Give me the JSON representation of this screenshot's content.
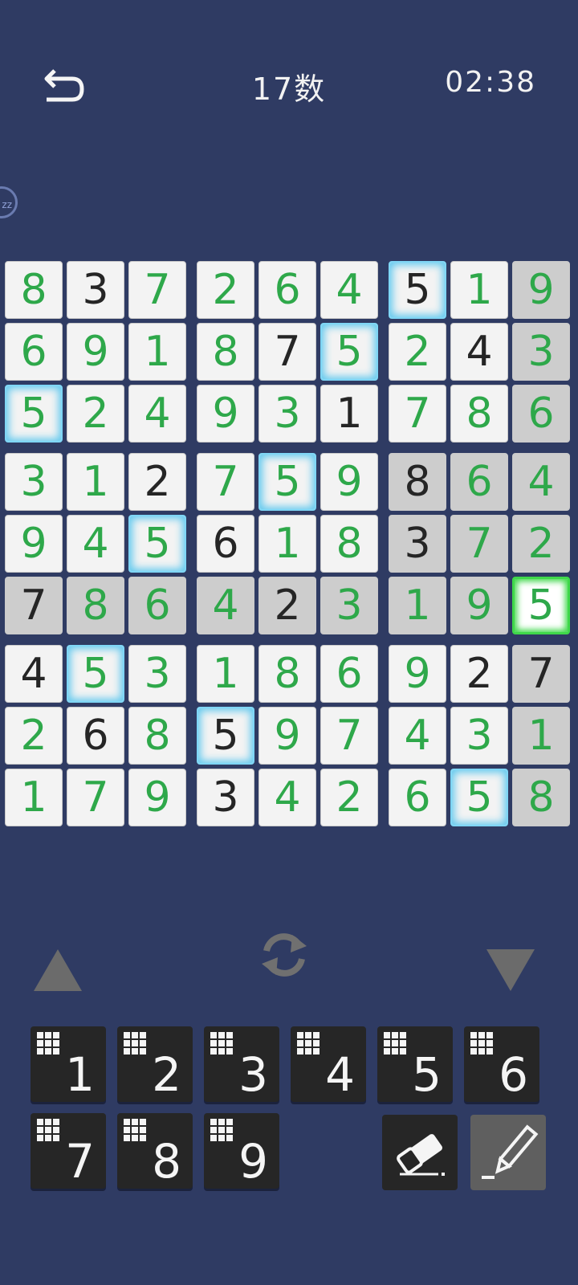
{
  "header": {
    "title": "17数",
    "timer": "02:38"
  },
  "sleep_label": "zz",
  "board": [
    [
      {
        "v": "8",
        "c": "g"
      },
      {
        "v": "3",
        "c": "b"
      },
      {
        "v": "7",
        "c": "g"
      },
      {
        "v": "2",
        "c": "g"
      },
      {
        "v": "6",
        "c": "g"
      },
      {
        "v": "4",
        "c": "g"
      },
      {
        "v": "5",
        "c": "b",
        "h": "glow"
      },
      {
        "v": "1",
        "c": "g"
      },
      {
        "v": "9",
        "c": "g",
        "h": "gray"
      }
    ],
    [
      {
        "v": "6",
        "c": "g"
      },
      {
        "v": "9",
        "c": "g"
      },
      {
        "v": "1",
        "c": "g"
      },
      {
        "v": "8",
        "c": "g"
      },
      {
        "v": "7",
        "c": "b"
      },
      {
        "v": "5",
        "c": "g",
        "h": "glow"
      },
      {
        "v": "2",
        "c": "g"
      },
      {
        "v": "4",
        "c": "b"
      },
      {
        "v": "3",
        "c": "g",
        "h": "gray"
      }
    ],
    [
      {
        "v": "5",
        "c": "g",
        "h": "glow"
      },
      {
        "v": "2",
        "c": "g"
      },
      {
        "v": "4",
        "c": "g"
      },
      {
        "v": "9",
        "c": "g"
      },
      {
        "v": "3",
        "c": "g"
      },
      {
        "v": "1",
        "c": "b"
      },
      {
        "v": "7",
        "c": "g"
      },
      {
        "v": "8",
        "c": "g"
      },
      {
        "v": "6",
        "c": "g",
        "h": "gray"
      }
    ],
    [
      {
        "v": "3",
        "c": "g"
      },
      {
        "v": "1",
        "c": "g"
      },
      {
        "v": "2",
        "c": "b"
      },
      {
        "v": "7",
        "c": "g"
      },
      {
        "v": "5",
        "c": "g",
        "h": "glow"
      },
      {
        "v": "9",
        "c": "g"
      },
      {
        "v": "8",
        "c": "b",
        "h": "gray"
      },
      {
        "v": "6",
        "c": "g",
        "h": "gray"
      },
      {
        "v": "4",
        "c": "g",
        "h": "gray"
      }
    ],
    [
      {
        "v": "9",
        "c": "g"
      },
      {
        "v": "4",
        "c": "g"
      },
      {
        "v": "5",
        "c": "g",
        "h": "glow"
      },
      {
        "v": "6",
        "c": "b"
      },
      {
        "v": "1",
        "c": "g"
      },
      {
        "v": "8",
        "c": "g"
      },
      {
        "v": "3",
        "c": "b",
        "h": "gray"
      },
      {
        "v": "7",
        "c": "g",
        "h": "gray"
      },
      {
        "v": "2",
        "c": "g",
        "h": "gray"
      }
    ],
    [
      {
        "v": "7",
        "c": "b",
        "h": "gray"
      },
      {
        "v": "8",
        "c": "g",
        "h": "gray"
      },
      {
        "v": "6",
        "c": "g",
        "h": "gray"
      },
      {
        "v": "4",
        "c": "g",
        "h": "gray"
      },
      {
        "v": "2",
        "c": "b",
        "h": "gray"
      },
      {
        "v": "3",
        "c": "g",
        "h": "gray"
      },
      {
        "v": "1",
        "c": "g",
        "h": "gray"
      },
      {
        "v": "9",
        "c": "g",
        "h": "gray"
      },
      {
        "v": "5",
        "c": "g",
        "h": "sel"
      }
    ],
    [
      {
        "v": "4",
        "c": "b"
      },
      {
        "v": "5",
        "c": "g",
        "h": "glow"
      },
      {
        "v": "3",
        "c": "g"
      },
      {
        "v": "1",
        "c": "g"
      },
      {
        "v": "8",
        "c": "g"
      },
      {
        "v": "6",
        "c": "g"
      },
      {
        "v": "9",
        "c": "g"
      },
      {
        "v": "2",
        "c": "b"
      },
      {
        "v": "7",
        "c": "b",
        "h": "gray"
      }
    ],
    [
      {
        "v": "2",
        "c": "g"
      },
      {
        "v": "6",
        "c": "b"
      },
      {
        "v": "8",
        "c": "g"
      },
      {
        "v": "5",
        "c": "b",
        "h": "glow"
      },
      {
        "v": "9",
        "c": "g"
      },
      {
        "v": "7",
        "c": "g"
      },
      {
        "v": "4",
        "c": "g"
      },
      {
        "v": "3",
        "c": "g"
      },
      {
        "v": "1",
        "c": "g",
        "h": "gray"
      }
    ],
    [
      {
        "v": "1",
        "c": "g"
      },
      {
        "v": "7",
        "c": "g"
      },
      {
        "v": "9",
        "c": "g"
      },
      {
        "v": "3",
        "c": "b"
      },
      {
        "v": "4",
        "c": "g"
      },
      {
        "v": "2",
        "c": "g"
      },
      {
        "v": "6",
        "c": "g"
      },
      {
        "v": "5",
        "c": "g",
        "h": "glow"
      },
      {
        "v": "8",
        "c": "g",
        "h": "gray"
      }
    ]
  ],
  "keypad": [
    "1",
    "2",
    "3",
    "4",
    "5",
    "6",
    "7",
    "8",
    "9"
  ],
  "colors": {
    "background": "#2f3b63",
    "given": "#252525",
    "entered": "#2ea84a",
    "highlight": "#62c9ee",
    "selected": "#3fd84a"
  },
  "icons": {
    "back": "undo-arrow-icon",
    "refresh": "refresh-icon",
    "up": "triangle-up-icon",
    "down": "triangle-down-icon",
    "erase": "eraser-icon",
    "pencil": "pencil-icon"
  }
}
